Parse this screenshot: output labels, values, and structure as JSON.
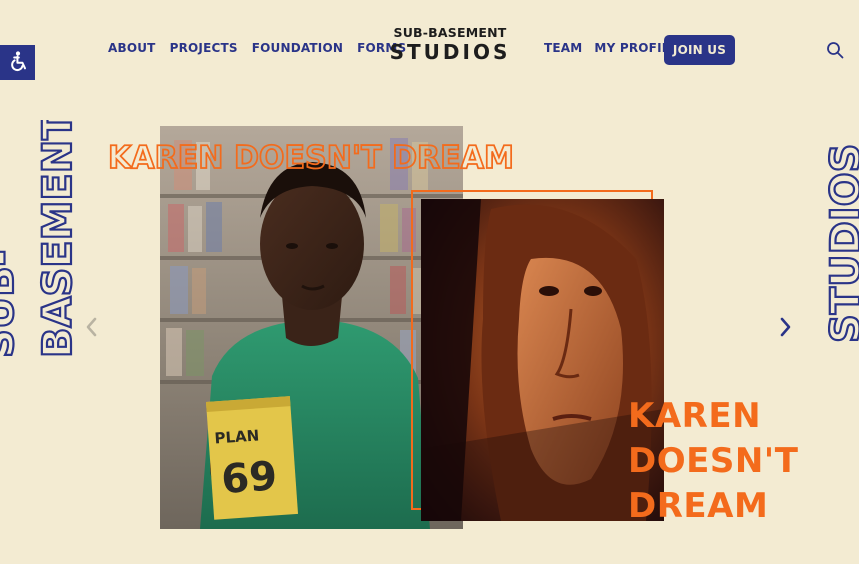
{
  "accessibility": {
    "icon": "accessibility-icon"
  },
  "nav": {
    "left_links": [
      "ABOUT",
      "PROJECTS",
      "FOUNDATION",
      "FORMS"
    ],
    "right_links": [
      "TEAM",
      "MY PROFILE"
    ],
    "join_label": "JOIN US",
    "search_icon": "search-icon"
  },
  "logo": {
    "top": "SUB-BASEMENT",
    "bottom": "STUDIOS"
  },
  "side_text": {
    "left_outer": "SUB-",
    "left_inner": "BASEMENT",
    "right": "STUDIOS"
  },
  "hero": {
    "title_outline": "KAREN DOESN'T DREAM",
    "title_solid": [
      "KAREN",
      "DOESN'T",
      "DREAM"
    ],
    "book_text": [
      "PLAN",
      "69"
    ]
  },
  "slider": {
    "prev_icon": "chevron-left-icon",
    "next_icon": "chevron-right-icon"
  },
  "colors": {
    "background": "#f3ebd2",
    "brand_blue": "#2a3488",
    "accent_orange": "#f36b1c",
    "logo_dark": "#1d1d1d"
  }
}
